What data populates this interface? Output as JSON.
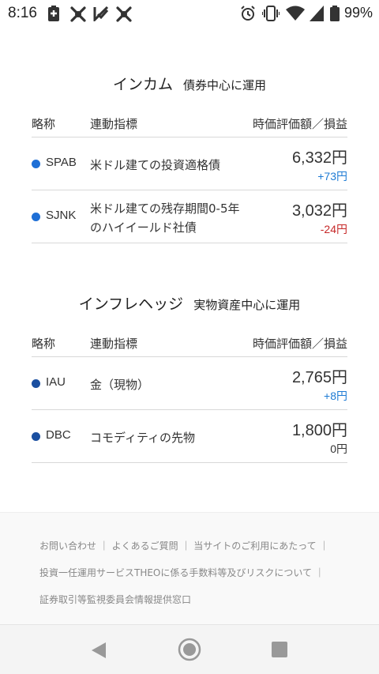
{
  "status_bar": {
    "time": "8:16",
    "battery_percent": "99%"
  },
  "colors": {
    "dot_blue": "#1e6fd6",
    "dot_navy": "#1a4fa0",
    "positive": "#1e7bd4",
    "negative": "#c62828",
    "neutral": "#333333"
  },
  "income": {
    "title": "インカム",
    "subtitle": "債券中心に運用",
    "headers": {
      "abbr": "略称",
      "index": "連動指標",
      "value": "時価評価額／損益"
    },
    "rows": [
      {
        "ticker": "SPAB",
        "index_name": "米ドル建ての投資適格債",
        "value": "6,332円",
        "change": "+73円"
      },
      {
        "ticker": "SJNK",
        "index_name": "米ドル建ての残存期間0-5年のハイイールド社債",
        "value": "3,032円",
        "change": "-24円"
      }
    ]
  },
  "inflation_hedge": {
    "title": "インフレヘッジ",
    "subtitle": "実物資産中心に運用",
    "headers": {
      "abbr": "略称",
      "index": "連動指標",
      "value": "時価評価額／損益"
    },
    "rows": [
      {
        "ticker": "IAU",
        "index_name": "金（現物）",
        "value": "2,765円",
        "change": "+8円"
      },
      {
        "ticker": "DBC",
        "index_name": "コモディティの先物",
        "value": "1,800円",
        "change": "0円"
      }
    ]
  },
  "footer": {
    "line1": "お問い合わせ ｜ よくあるご質問 ｜ 当サイトのご利用にあたって ｜",
    "line2": "投資一任運用サービスTHEOに係る手数料等及びリスクについて ｜",
    "line3": "証券取引等監視委員会情報提供窓口"
  }
}
